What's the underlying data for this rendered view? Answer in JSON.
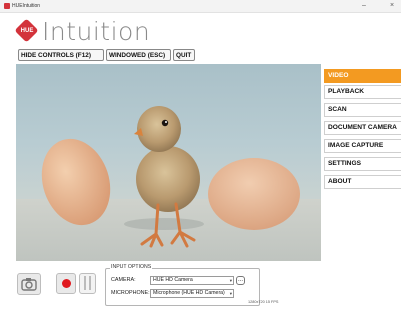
{
  "window": {
    "title": "HUEIntuition",
    "minimize": "–",
    "close": "×"
  },
  "brand": {
    "logo_text": "HUE",
    "name": "Intuition",
    "accent": "#d3333b"
  },
  "toolbar": {
    "hide_controls": "HIDE CONTROLS (F12)",
    "windowed": "WINDOWED (ESC)",
    "quit": "QUIT"
  },
  "menu": {
    "items": [
      {
        "label": "VIDEO",
        "active": true
      },
      {
        "label": "PLAYBACK",
        "active": false
      },
      {
        "label": "SCAN",
        "active": false
      },
      {
        "label": "DOCUMENT CAMERA",
        "active": false
      },
      {
        "label": "IMAGE CAPTURE",
        "active": false
      },
      {
        "label": "SETTINGS",
        "active": false
      },
      {
        "label": "ABOUT",
        "active": false
      }
    ],
    "active_color": "#f39a21"
  },
  "controls": {
    "capture_icon": "camera-icon",
    "record_icon": "record-icon",
    "pause_icon": "pause-icon"
  },
  "input_options": {
    "legend": "INPUT OPTIONS",
    "camera_label": "CAMERA:",
    "camera_value": "HUE HD Camera",
    "microphone_label": "MICROPHONE:",
    "microphone_value": "Microphone (HUE HD Camera)",
    "more_label": "..."
  },
  "status": {
    "resolution_fps": "1280x720 15 FPS"
  }
}
